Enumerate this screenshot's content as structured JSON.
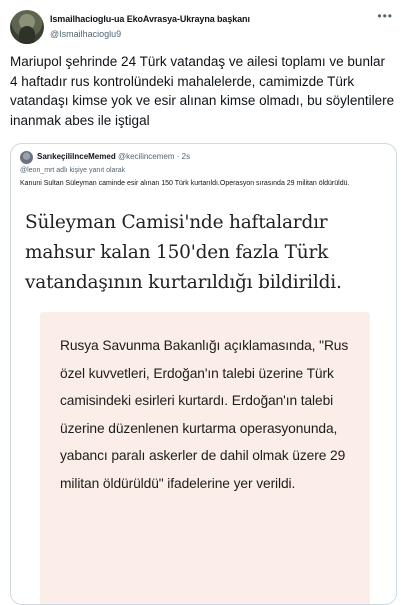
{
  "tweet": {
    "display_name": "Ismailhacioglu-ua EkoAvrasya-Ukrayna başkanı",
    "handle": "@Ismailhacioglu9",
    "more_icon": "more-horizontal-icon",
    "text": "Mariupol şehrinde 24 Türk vatandaş ve ailesi toplamı ve bunlar 4 haftadır rus kontrolündeki mahalelerde, camimizde Türk vatandaşı kimse yok ve esir alınan kimse olmadı, bu söylentilere inanmak abes ile iştigal"
  },
  "quote": {
    "name": "SarıkeçililnceMemed",
    "handle": "@kecilincemem",
    "separator": "·",
    "time": "2s",
    "reply_to": "@leon_mrt adlı kişiye yanıt olarak",
    "text": "Kanuni Sultan Süleyman caminde esir alınan 150 Türk kurtarıldı.Operasyon sırasında 29 militan öldürüldü.",
    "image": {
      "headline": "Süleyman Camisi'nde haftalardır mahsur kalan 150'den fazla Türk vatandaşının kurtarıldığı bildirildi.",
      "statement": "Rusya Savunma Bakanlığı açıklamasında, \"Rus özel kuvvetleri, Erdoğan'ın talebi üzerine Türk camisindeki esirleri kurtardı. Erdoğan'ın talebi üzerine düzenlenen kurtarma operasyonunda, yabancı paralı askerler de dahil olmak üzere 29 militan öldürüldü\" ifadelerine yer verildi."
    }
  }
}
